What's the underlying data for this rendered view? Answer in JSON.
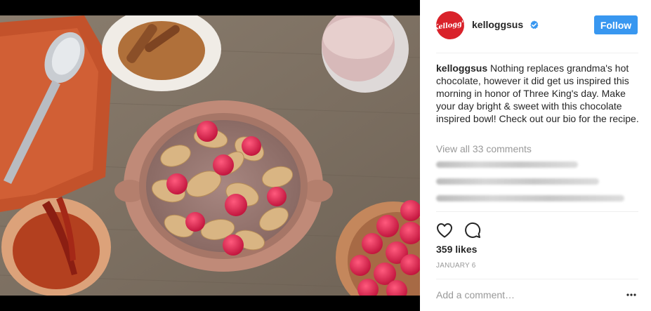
{
  "post": {
    "username": "kelloggsus",
    "avatar_text": "Kellogg's",
    "follow_label": "Follow",
    "caption_username": "kelloggsus",
    "caption_text": " Nothing replaces grandma's hot chocolate, however it did get us inspired this morning in honor of Three King's day. Make your day bright & sweet with this chocolate inspired bowl! Check out our bio for the recipe.",
    "view_all_comments": "View all 33 comments",
    "likes": "359 likes",
    "date": "JANUARY 6",
    "comment_placeholder": "Add a comment…"
  },
  "icons": {
    "verified": "verified-badge-icon",
    "like": "heart-icon",
    "comment": "comment-bubble-icon",
    "more": "more-options-icon"
  },
  "colors": {
    "follow_button": "#3897f0",
    "avatar_bg": "#d9222a",
    "verified": "#3897f0",
    "secondary_text": "#999999"
  }
}
